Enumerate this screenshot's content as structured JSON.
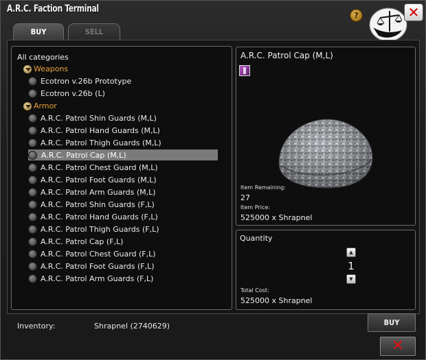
{
  "window": {
    "title": "A.R.C. Faction Terminal"
  },
  "tabs": [
    {
      "label": "BUY"
    },
    {
      "label": "SELL"
    }
  ],
  "icons": {
    "help": "help-icon",
    "logo": "faction-scales-logo-icon",
    "close": "close-icon",
    "category": "category-expand-icon",
    "bullet": "list-bullet-icon",
    "item": "item-thumbnail-icon"
  },
  "top_help_glyph": "?",
  "close_glyph": "✕",
  "list": {
    "root": "All categories",
    "categories": [
      {
        "name": "Weapons",
        "items": [
          "Ecotron v.26b Prototype",
          "Ecotron v.26b (L)"
        ]
      },
      {
        "name": "Armor",
        "items": [
          "A.R.C. Patrol Shin Guards (M,L)",
          "A.R.C. Patrol Hand Guards (M,L)",
          "A.R.C. Patrol Thigh Guards (M,L)",
          "A.R.C. Patrol Cap (M,L)",
          "A.R.C. Patrol Chest Guard (M,L)",
          "A.R.C. Patrol Foot Guards (M,L)",
          "A.R.C. Patrol Arm Guards (M,L)",
          "A.R.C. Patrol Shin Guards (F,L)",
          "A.R.C. Patrol Hand Guards (F,L)",
          "A.R.C. Patrol Thigh Guards (F,L)",
          "A.R.C. Patrol Cap (F,L)",
          "A.R.C. Patrol Chest Guard (F,L)",
          "A.R.C. Patrol Foot Guards (F,L)",
          "A.R.C. Patrol Arm Guards (F,L)"
        ]
      }
    ],
    "selected": "A.R.C. Patrol Cap (M,L)"
  },
  "item": {
    "name": "A.R.C. Patrol Cap (M,L)",
    "remaining_label": "Item Remaining:",
    "remaining": "27",
    "price_label": "Item Price:",
    "price": "525000 x Shrapnel"
  },
  "quantity": {
    "title": "Quantity",
    "value": "1",
    "up_glyph": "▲",
    "down_glyph": "▼",
    "total_label": "Total Cost:",
    "total": "525000 x Shrapnel"
  },
  "inventory": {
    "label": "Inventory:",
    "value": "Shrapnel (2740629)"
  },
  "buttons": {
    "buy": "BUY"
  },
  "colors": {
    "category": "#e8a33c",
    "selected_row": "#7b7b7b",
    "close_red": "#e01010"
  }
}
